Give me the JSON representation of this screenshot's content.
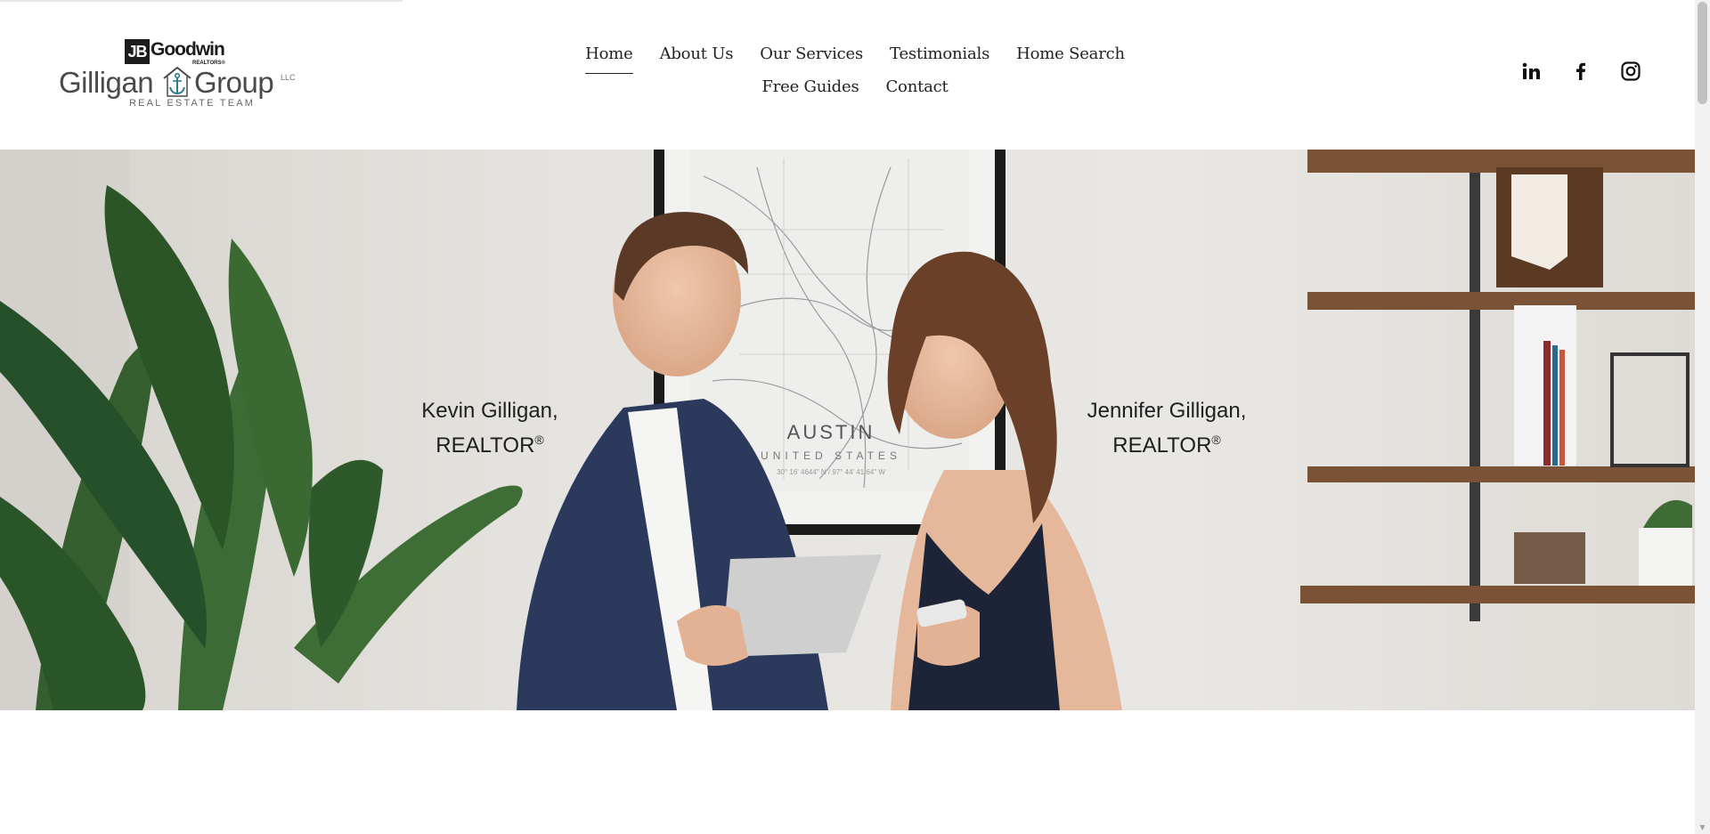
{
  "logo": {
    "jb": "JB",
    "goodwin": "Goodwin",
    "realtors": "REALTORS®",
    "gilligan": "Gilligan",
    "group": "Group",
    "llc": "LLC",
    "team": "REAL ESTATE TEAM"
  },
  "nav": {
    "row1": [
      {
        "label": "Home",
        "active": true
      },
      {
        "label": "About Us"
      },
      {
        "label": "Our Services"
      },
      {
        "label": "Testimonials"
      },
      {
        "label": "Home Search"
      }
    ],
    "row2": [
      {
        "label": "Free Guides"
      },
      {
        "label": "Contact"
      }
    ]
  },
  "social": [
    {
      "name": "linkedin-icon"
    },
    {
      "name": "facebook-icon"
    },
    {
      "name": "instagram-icon"
    }
  ],
  "hero": {
    "left_caption": {
      "name": "Kevin Gilligan,",
      "title": "REALTOR",
      "mark": "®"
    },
    "right_caption": {
      "name": "Jennifer Gilligan,",
      "title": "REALTOR",
      "mark": "®"
    },
    "map_city": "AUSTIN",
    "map_country": "UNITED STATES",
    "map_coords": "30° 16' 4644\" N / 97° 44' 41.64\" W"
  },
  "colors": {
    "text": "#1f1f1f",
    "wall": "#e4e2de",
    "jacket": "#2b3a5c",
    "dress": "#1e2438",
    "plant": "#2f5a2c",
    "shelf": "#7a5236"
  }
}
